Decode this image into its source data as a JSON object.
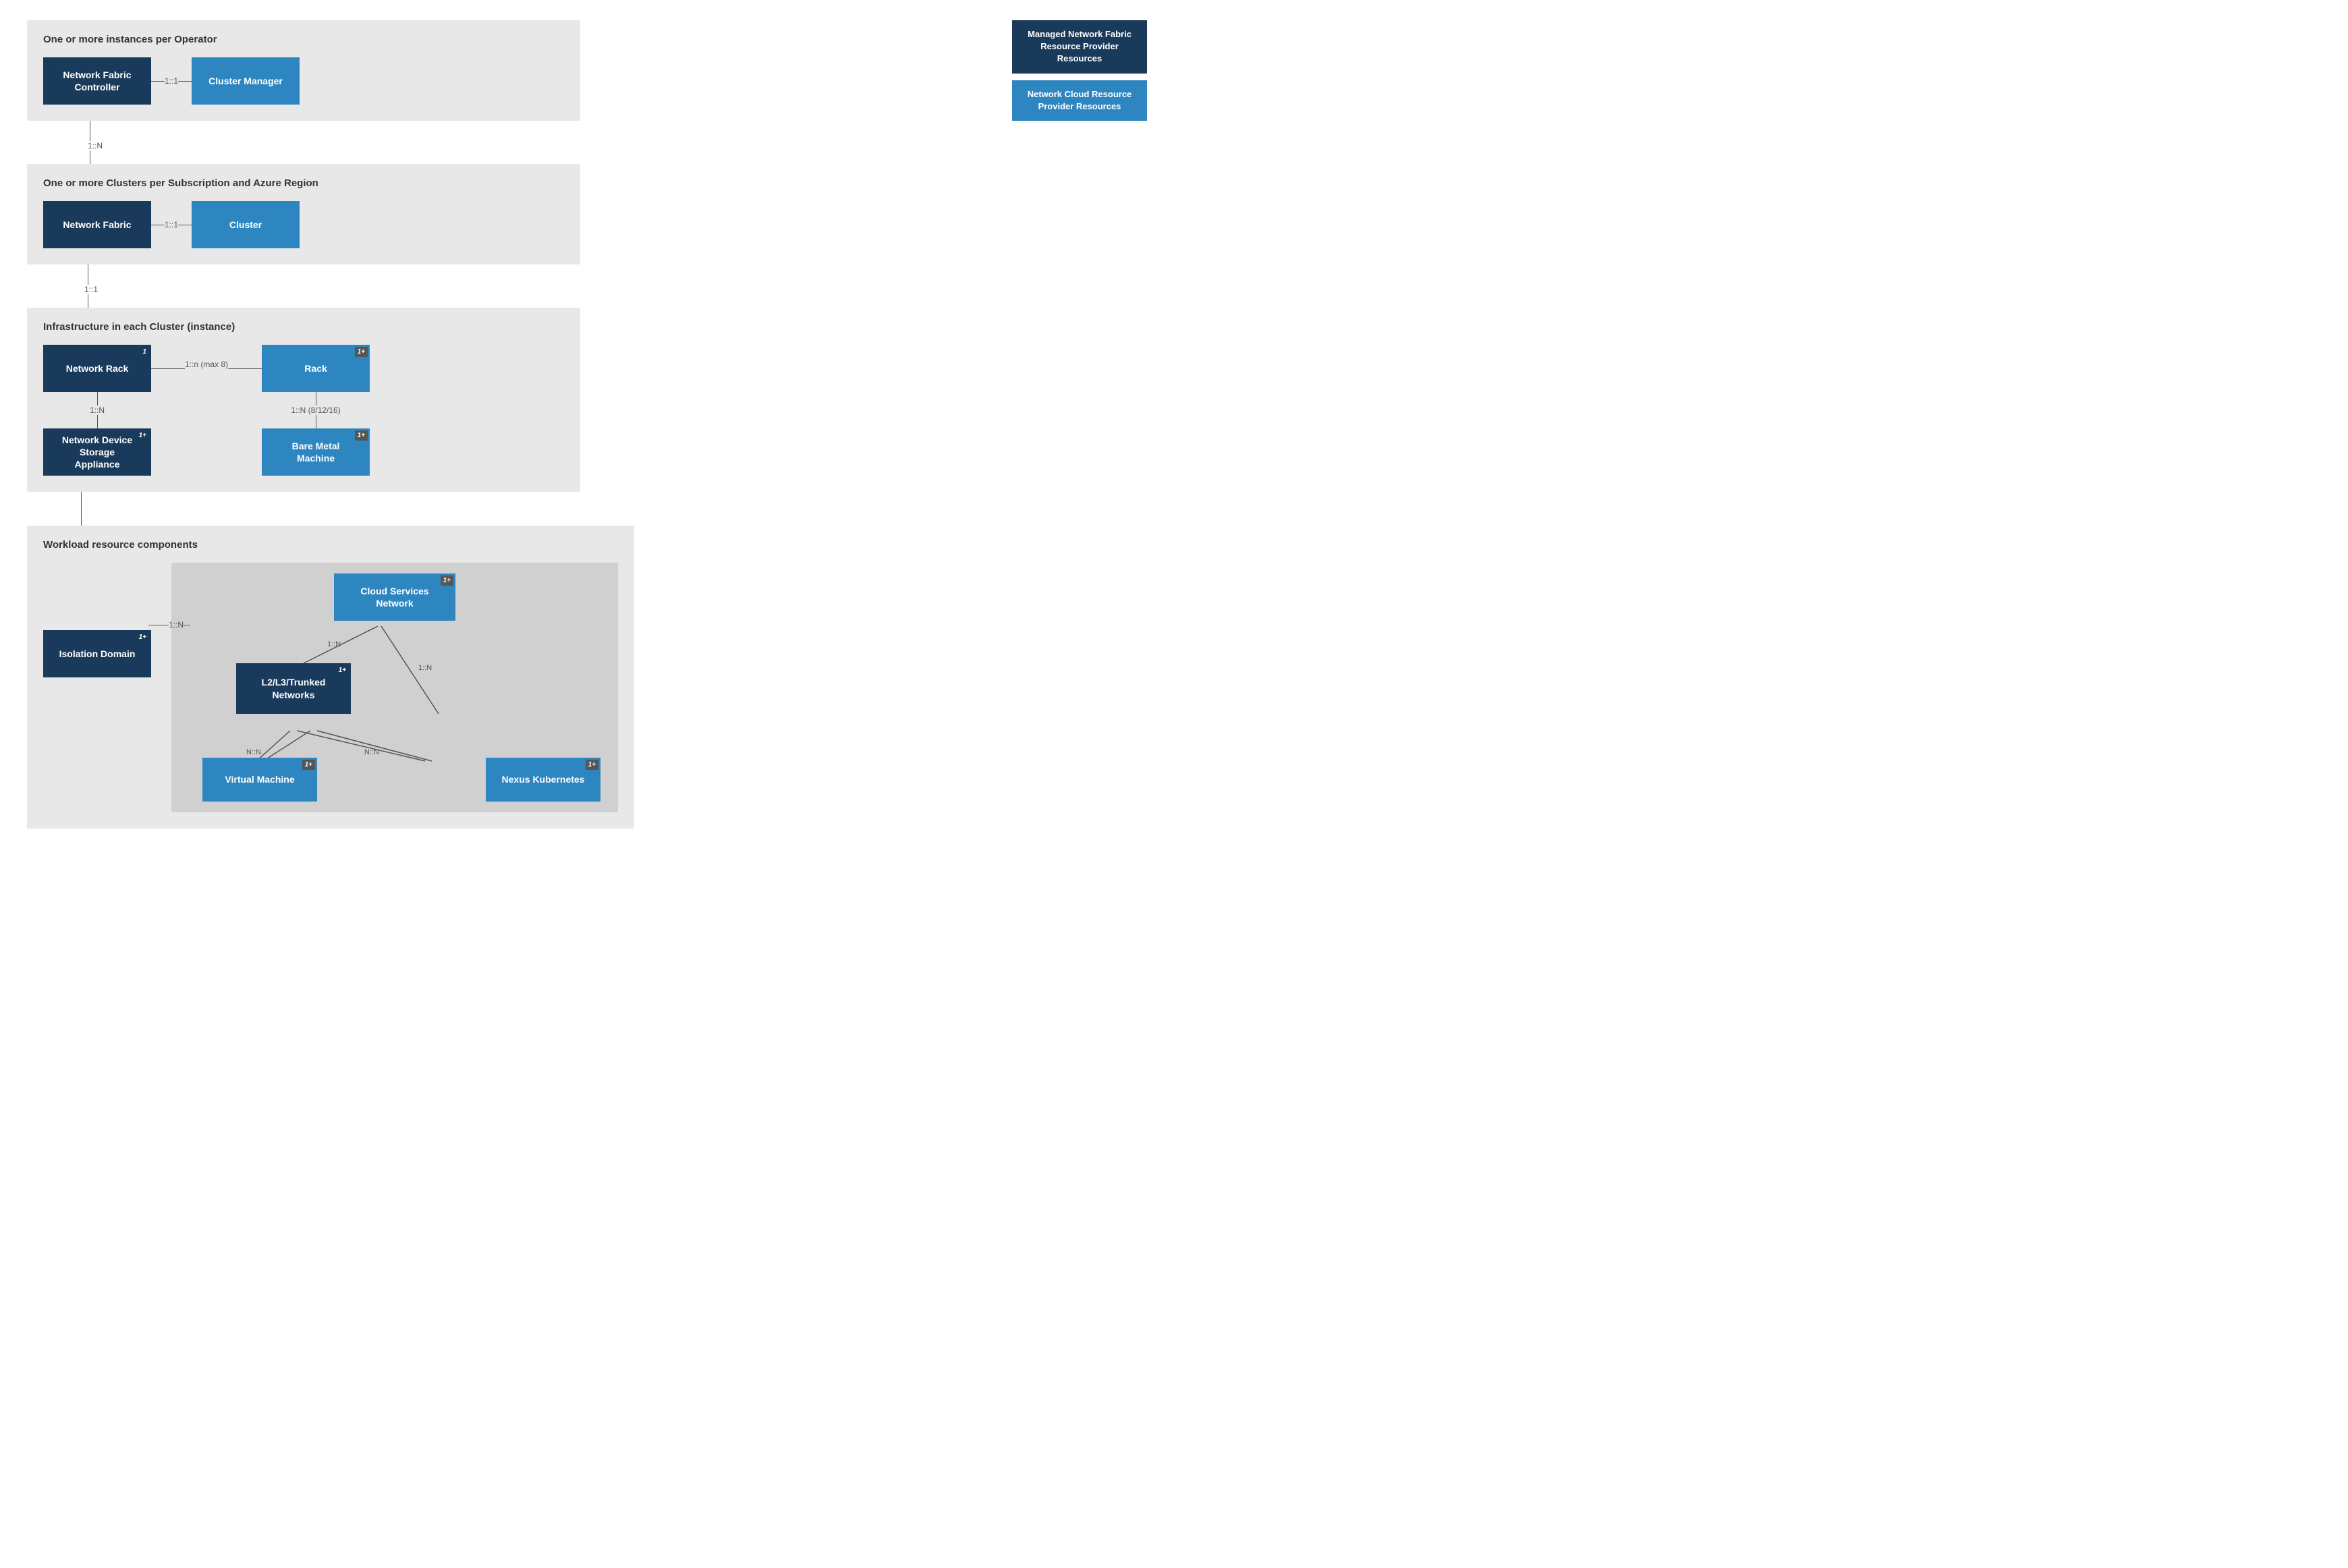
{
  "legend": {
    "item1": "Managed Network Fabric Resource Provider Resources",
    "item2": "Network Cloud Resource Provider Resources"
  },
  "section1": {
    "title": "One or more instances per Operator",
    "node1": "Network Fabric Controller",
    "node2": "Cluster Manager",
    "connector": "1::1",
    "below_connector": "1::N"
  },
  "section2": {
    "title": "One or more Clusters per Subscription and Azure Region",
    "node1": "Network Fabric",
    "node2": "Cluster",
    "connector": "1::1",
    "below_connector": "1::1"
  },
  "section3": {
    "title": "Infrastructure in each Cluster (instance)",
    "left_node1": "Network Rack",
    "left_node1_badge": "1",
    "left_node2": "Network Device Storage Appliance",
    "left_node2_badge": "1+",
    "left_connector": "1::N",
    "right_node1": "Rack",
    "right_node1_badge": "1+",
    "right_node2": "Bare Metal Machine",
    "right_node2_badge": "1+",
    "right_connector": "1::N (8/12/16)",
    "h_connector": "1::n (max 8)"
  },
  "section4": {
    "title": "Workload resource components",
    "isolation_domain": "Isolation Domain",
    "isolation_badge": "1+",
    "isolation_connector": "1::N",
    "cloud_services": "Cloud Services Network",
    "cloud_services_badge": "1+",
    "l2l3": "L2/L3/Trunked Networks",
    "l2l3_badge": "1+",
    "l2l3_connector": "1::N",
    "csn_connector": "1::N",
    "virtual_machine": "Virtual Machine",
    "virtual_machine_badge": "1+",
    "nexus": "Nexus Kubernetes",
    "nexus_badge": "1+",
    "vm_connector": "N::N",
    "nexus_connector": "N::N"
  }
}
